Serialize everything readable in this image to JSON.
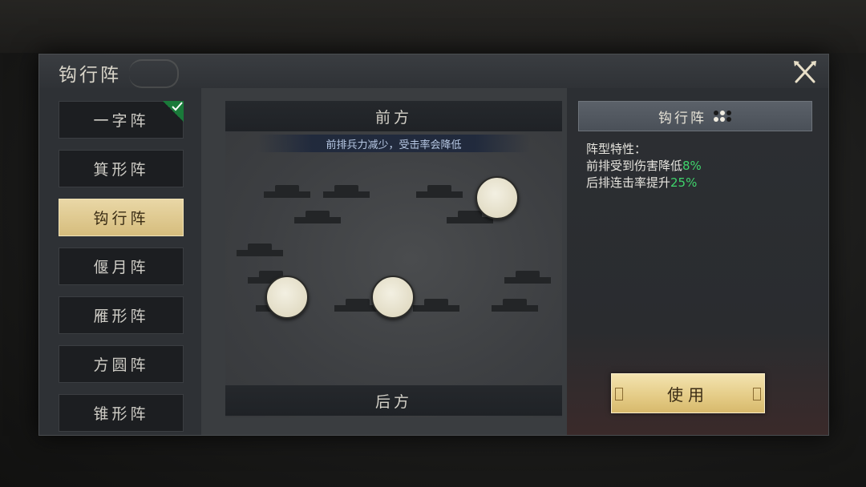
{
  "dialog": {
    "title": "钩行阵",
    "close_icon": "close-x-icon"
  },
  "formation_list": {
    "items": [
      {
        "label": "一字阵",
        "checked": true,
        "selected": false
      },
      {
        "label": "箕形阵",
        "checked": false,
        "selected": false
      },
      {
        "label": "钩行阵",
        "checked": false,
        "selected": true
      },
      {
        "label": "偃月阵",
        "checked": false,
        "selected": false
      },
      {
        "label": "雁形阵",
        "checked": false,
        "selected": false
      },
      {
        "label": "方圆阵",
        "checked": false,
        "selected": false
      },
      {
        "label": "锥形阵",
        "checked": false,
        "selected": false
      }
    ]
  },
  "board": {
    "front_label": "前方",
    "front_hint": "前排兵力减少，受击率会降低",
    "back_label": "后方",
    "unit_count": 3
  },
  "info": {
    "header_title": "钩行阵",
    "traits_label": "阵型特性：",
    "trait_1_text": "前排受到伤害降低",
    "trait_1_value": "8%",
    "trait_2_text": "后排连击率提升",
    "trait_2_value": "25%",
    "use_label": "使用"
  },
  "colors": {
    "selected_gold": "#e0c98b",
    "highlight_green": "#3fd46c",
    "check_green": "#1a7a3a"
  }
}
